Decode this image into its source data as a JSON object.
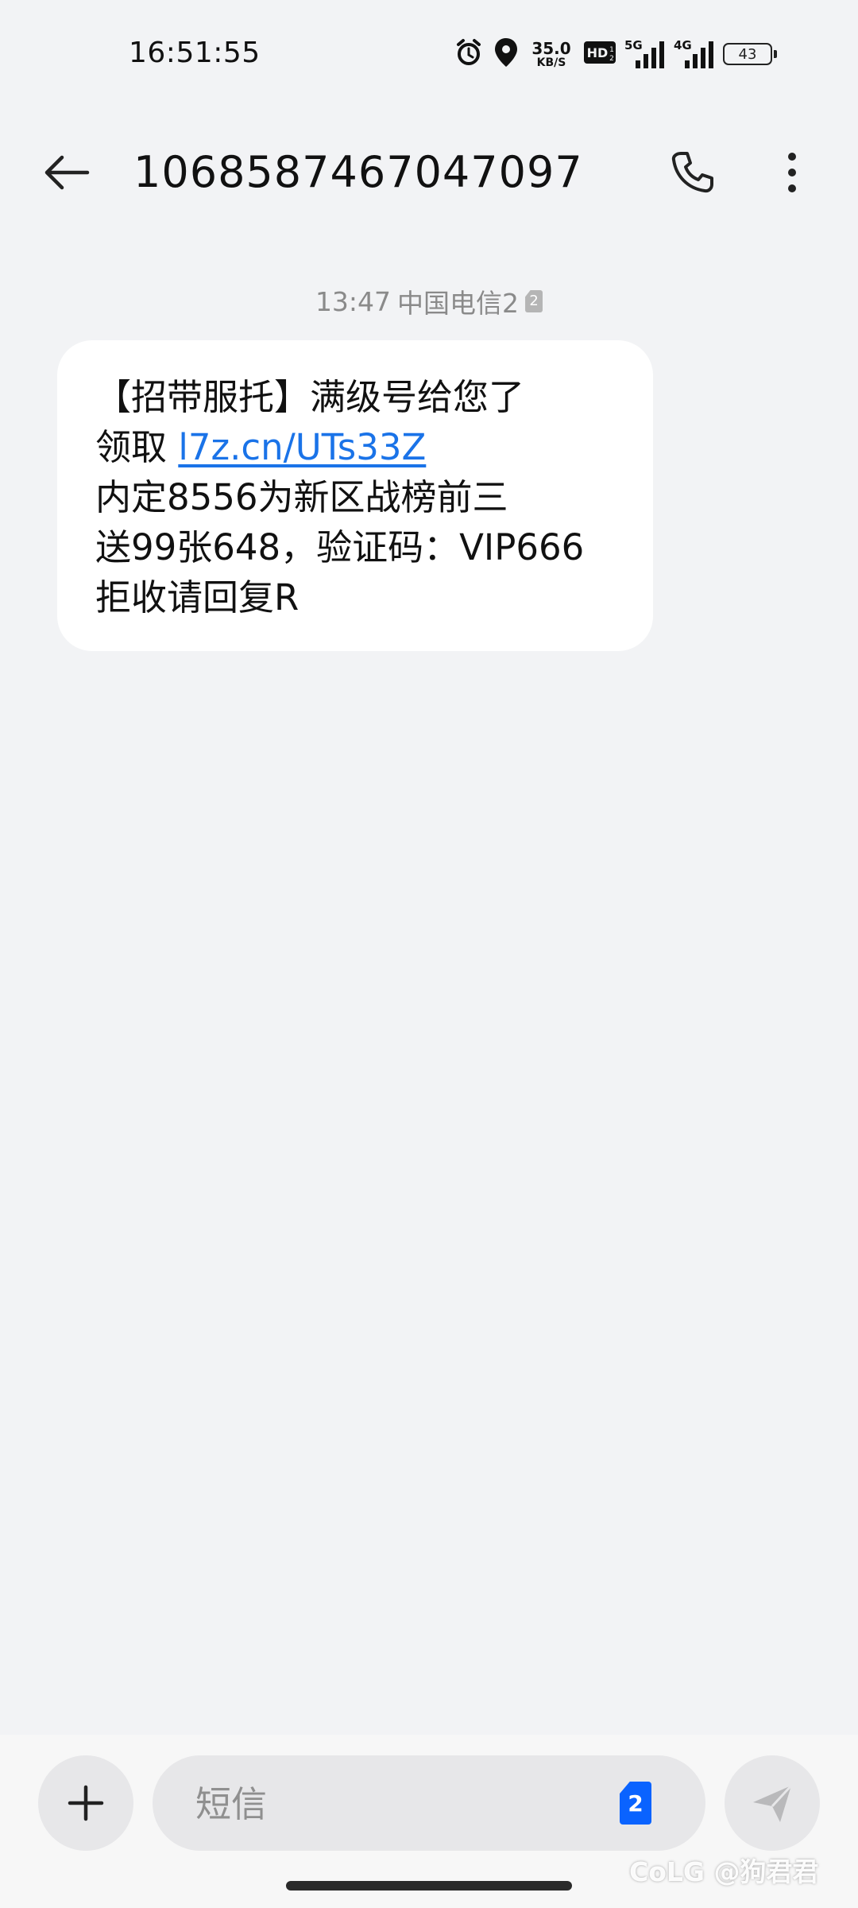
{
  "status_bar": {
    "time": "16:51:55",
    "net_speed_value": "35.0",
    "net_speed_unit": "KB/S",
    "hd_label": "HD",
    "sim1_network": "5G",
    "sim2_network": "4G",
    "battery_level": "43"
  },
  "header": {
    "title": "1068587467047097"
  },
  "conversation": {
    "timestamp": "13:47",
    "carrier": "中国电信2",
    "sim_badge": "2",
    "message": {
      "line1": "【招带服托】满级号给您了",
      "line2_prefix": "领取 ",
      "link": "l7z.cn/UTs33Z",
      "line3": "内定8556为新区战榜前三",
      "line4": "送99张648，验证码：VIP666",
      "line5": "拒收请回复R"
    }
  },
  "composer": {
    "placeholder": "短信",
    "sim_selector": "2"
  },
  "watermark": "CoLG @狗君君",
  "colors": {
    "background": "#f2f3f5",
    "bubble": "#ffffff",
    "link": "#1a73e8",
    "sim_selector": "#0a63ff"
  },
  "icons": {
    "alarm": "alarm-icon",
    "location": "location-icon",
    "back": "back-arrow-icon",
    "call": "phone-icon",
    "more": "more-vert-icon",
    "add": "plus-icon",
    "send": "send-icon"
  }
}
